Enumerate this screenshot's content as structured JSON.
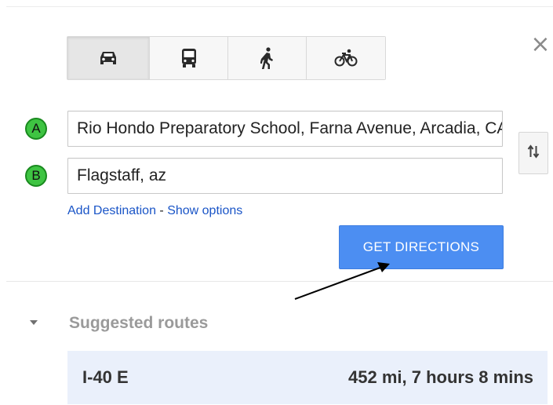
{
  "travel_modes": {
    "selected": "driving",
    "items": [
      {
        "id": "driving",
        "icon": "car-icon"
      },
      {
        "id": "transit",
        "icon": "bus-icon"
      },
      {
        "id": "walking",
        "icon": "walking-icon"
      },
      {
        "id": "bicycling",
        "icon": "bicycle-icon"
      }
    ]
  },
  "close": {
    "label": "×"
  },
  "waypoints": {
    "a": {
      "marker": "A",
      "value": "Rio Hondo Preparatory School, Farna Avenue, Arcadia, CA"
    },
    "b": {
      "marker": "B",
      "value": "Flagstaff, az"
    }
  },
  "swap": {
    "icon": "swap-arrows-icon"
  },
  "links": {
    "add_destination": "Add Destination",
    "separator": " - ",
    "show_options": "Show options"
  },
  "get_directions": {
    "label": "GET DIRECTIONS"
  },
  "suggested_routes": {
    "title": "Suggested routes",
    "routes": [
      {
        "name": "I-40 E",
        "info": "452 mi, 7 hours 8 mins"
      }
    ]
  },
  "colors": {
    "marker_fill": "#3ec442",
    "button_blue": "#4c8ef2",
    "link_blue": "#1a55c7",
    "route_bg": "#eaf0fb"
  }
}
